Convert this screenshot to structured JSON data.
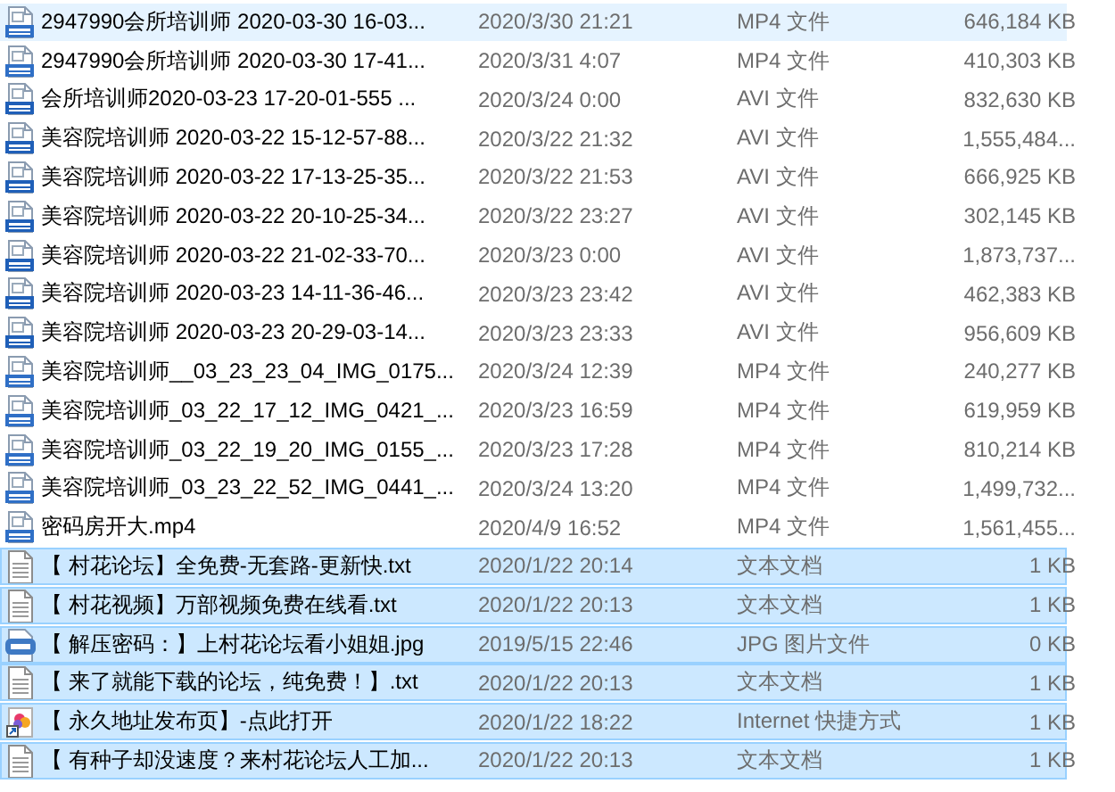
{
  "rows": [
    {
      "kind": "mp4",
      "name": "2947990会所培训师 2020-03-30 16-03...",
      "date": "2020/3/30 21:21",
      "type": "MP4 文件",
      "size": "646,184 KB",
      "selected": false,
      "hovered": true
    },
    {
      "kind": "mp4",
      "name": "2947990会所培训师 2020-03-30 17-41...",
      "date": "2020/3/31 4:07",
      "type": "MP4 文件",
      "size": "410,303 KB",
      "selected": false,
      "hovered": false
    },
    {
      "kind": "avi",
      "name": "会所培训师2020-03-23 17-20-01-555 ...",
      "date": "2020/3/24 0:00",
      "type": "AVI 文件",
      "size": "832,630 KB",
      "selected": false,
      "hovered": false
    },
    {
      "kind": "avi",
      "name": "美容院培训师 2020-03-22 15-12-57-88...",
      "date": "2020/3/22 21:32",
      "type": "AVI 文件",
      "size": "1,555,484...",
      "selected": false,
      "hovered": false
    },
    {
      "kind": "avi",
      "name": "美容院培训师 2020-03-22 17-13-25-35...",
      "date": "2020/3/22 21:53",
      "type": "AVI 文件",
      "size": "666,925 KB",
      "selected": false,
      "hovered": false
    },
    {
      "kind": "avi",
      "name": "美容院培训师 2020-03-22 20-10-25-34...",
      "date": "2020/3/22 23:27",
      "type": "AVI 文件",
      "size": "302,145 KB",
      "selected": false,
      "hovered": false
    },
    {
      "kind": "avi",
      "name": "美容院培训师 2020-03-22 21-02-33-70...",
      "date": "2020/3/23 0:00",
      "type": "AVI 文件",
      "size": "1,873,737...",
      "selected": false,
      "hovered": false
    },
    {
      "kind": "avi",
      "name": "美容院培训师 2020-03-23 14-11-36-46...",
      "date": "2020/3/23 23:42",
      "type": "AVI 文件",
      "size": "462,383 KB",
      "selected": false,
      "hovered": false
    },
    {
      "kind": "avi",
      "name": "美容院培训师 2020-03-23 20-29-03-14...",
      "date": "2020/3/23 23:33",
      "type": "AVI 文件",
      "size": "956,609 KB",
      "selected": false,
      "hovered": false
    },
    {
      "kind": "mp4",
      "name": "美容院培训师__03_23_23_04_IMG_0175...",
      "date": "2020/3/24 12:39",
      "type": "MP4 文件",
      "size": "240,277 KB",
      "selected": false,
      "hovered": false
    },
    {
      "kind": "mp4",
      "name": "美容院培训师_03_22_17_12_IMG_0421_...",
      "date": "2020/3/23 16:59",
      "type": "MP4 文件",
      "size": "619,959 KB",
      "selected": false,
      "hovered": false
    },
    {
      "kind": "mp4",
      "name": "美容院培训师_03_22_19_20_IMG_0155_...",
      "date": "2020/3/23 17:28",
      "type": "MP4 文件",
      "size": "810,214 KB",
      "selected": false,
      "hovered": false
    },
    {
      "kind": "mp4",
      "name": "美容院培训师_03_23_22_52_IMG_0441_...",
      "date": "2020/3/24 13:20",
      "type": "MP4 文件",
      "size": "1,499,732...",
      "selected": false,
      "hovered": false
    },
    {
      "kind": "mp4",
      "name": "密码房开大.mp4",
      "date": "2020/4/9 16:52",
      "type": "MP4 文件",
      "size": "1,561,455...",
      "selected": false,
      "hovered": false
    },
    {
      "kind": "txt",
      "name": "【 村花论坛】全免费-无套路-更新快.txt",
      "date": "2020/1/22 20:14",
      "type": "文本文档",
      "size": "1 KB",
      "selected": true,
      "hovered": false
    },
    {
      "kind": "txt",
      "name": "【 村花视频】万部视频免费在线看.txt",
      "date": "2020/1/22 20:13",
      "type": "文本文档",
      "size": "1 KB",
      "selected": true,
      "hovered": false
    },
    {
      "kind": "jpg",
      "name": "【 解压密码：】上村花论坛看小姐姐.jpg",
      "date": "2019/5/15 22:46",
      "type": "JPG 图片文件",
      "size": "0 KB",
      "selected": true,
      "hovered": false
    },
    {
      "kind": "txt",
      "name": "【 来了就能下载的论坛，纯免费！】.txt",
      "date": "2020/1/22 20:13",
      "type": "文本文档",
      "size": "1 KB",
      "selected": true,
      "hovered": false
    },
    {
      "kind": "url",
      "name": "【 永久地址发布页】-点此打开",
      "date": "2020/1/22 18:22",
      "type": "Internet 快捷方式",
      "size": "1 KB",
      "selected": true,
      "hovered": false
    },
    {
      "kind": "txt",
      "name": "【 有种子却没速度？来村花论坛人工加...",
      "date": "2020/1/22 20:13",
      "type": "文本文档",
      "size": "1 KB",
      "selected": true,
      "hovered": false
    }
  ]
}
